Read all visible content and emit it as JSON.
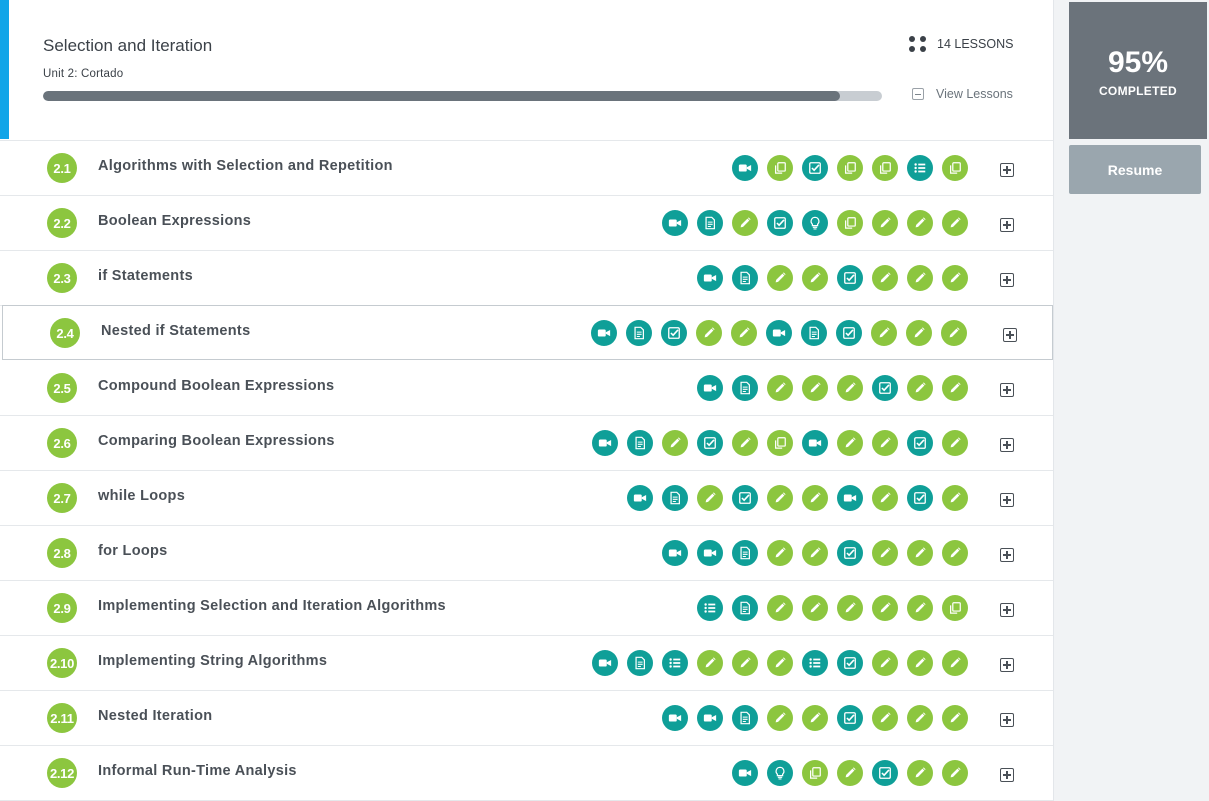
{
  "unit": {
    "title": "Selection and Iteration",
    "subtitle": "Unit 2: Cortado",
    "progress": 0.95,
    "lessons_count_label": "14 LESSONS",
    "view_lessons_label": "View Lessons"
  },
  "completion": {
    "percent_label": "95%",
    "completed_label": "COMPLETED",
    "resume_label": "Resume"
  },
  "colors": {
    "accent": "#10a5e8",
    "teal": "#0f9f98",
    "green": "#8cc63f",
    "completion_box": "#6b737b",
    "resume_button": "#9aa6ae"
  },
  "lessons": [
    {
      "num": "2.1",
      "title": "Algorithms with Selection and Repetition",
      "activities": [
        {
          "icon": "video",
          "color": "teal"
        },
        {
          "icon": "copy",
          "color": "green"
        },
        {
          "icon": "check",
          "color": "teal"
        },
        {
          "icon": "copy",
          "color": "green"
        },
        {
          "icon": "copy",
          "color": "green"
        },
        {
          "icon": "list",
          "color": "teal"
        },
        {
          "icon": "copy",
          "color": "green"
        }
      ]
    },
    {
      "num": "2.2",
      "title": "Boolean Expressions",
      "activities": [
        {
          "icon": "video",
          "color": "teal"
        },
        {
          "icon": "document",
          "color": "teal"
        },
        {
          "icon": "pencil",
          "color": "green"
        },
        {
          "icon": "check",
          "color": "teal"
        },
        {
          "icon": "bulb",
          "color": "teal"
        },
        {
          "icon": "copy",
          "color": "green"
        },
        {
          "icon": "pencil",
          "color": "green"
        },
        {
          "icon": "pencil",
          "color": "green"
        },
        {
          "icon": "pencil",
          "color": "green"
        }
      ]
    },
    {
      "num": "2.3",
      "title": "if Statements",
      "activities": [
        {
          "icon": "video",
          "color": "teal"
        },
        {
          "icon": "document",
          "color": "teal"
        },
        {
          "icon": "pencil",
          "color": "green"
        },
        {
          "icon": "pencil",
          "color": "green"
        },
        {
          "icon": "check",
          "color": "teal"
        },
        {
          "icon": "pencil",
          "color": "green"
        },
        {
          "icon": "pencil",
          "color": "green"
        },
        {
          "icon": "pencil",
          "color": "green"
        }
      ]
    },
    {
      "num": "2.4",
      "title": "Nested if Statements",
      "activities": [
        {
          "icon": "video",
          "color": "teal"
        },
        {
          "icon": "document",
          "color": "teal"
        },
        {
          "icon": "check",
          "color": "teal"
        },
        {
          "icon": "pencil",
          "color": "green"
        },
        {
          "icon": "pencil",
          "color": "green"
        },
        {
          "icon": "video",
          "color": "teal"
        },
        {
          "icon": "document",
          "color": "teal"
        },
        {
          "icon": "check",
          "color": "teal"
        },
        {
          "icon": "pencil",
          "color": "green"
        },
        {
          "icon": "pencil",
          "color": "green"
        },
        {
          "icon": "pencil",
          "color": "green"
        }
      ]
    },
    {
      "num": "2.5",
      "title": "Compound Boolean Expressions",
      "activities": [
        {
          "icon": "video",
          "color": "teal"
        },
        {
          "icon": "document",
          "color": "teal"
        },
        {
          "icon": "pencil",
          "color": "green"
        },
        {
          "icon": "pencil",
          "color": "green"
        },
        {
          "icon": "pencil",
          "color": "green"
        },
        {
          "icon": "check",
          "color": "teal"
        },
        {
          "icon": "pencil",
          "color": "green"
        },
        {
          "icon": "pencil",
          "color": "green"
        }
      ]
    },
    {
      "num": "2.6",
      "title": "Comparing Boolean Expressions",
      "activities": [
        {
          "icon": "video",
          "color": "teal"
        },
        {
          "icon": "document",
          "color": "teal"
        },
        {
          "icon": "pencil",
          "color": "green"
        },
        {
          "icon": "check",
          "color": "teal"
        },
        {
          "icon": "pencil",
          "color": "green"
        },
        {
          "icon": "copy",
          "color": "green"
        },
        {
          "icon": "video",
          "color": "teal"
        },
        {
          "icon": "pencil",
          "color": "green"
        },
        {
          "icon": "pencil",
          "color": "green"
        },
        {
          "icon": "check",
          "color": "teal"
        },
        {
          "icon": "pencil",
          "color": "green"
        }
      ]
    },
    {
      "num": "2.7",
      "title": "while Loops",
      "activities": [
        {
          "icon": "video",
          "color": "teal"
        },
        {
          "icon": "document",
          "color": "teal"
        },
        {
          "icon": "pencil",
          "color": "green"
        },
        {
          "icon": "check",
          "color": "teal"
        },
        {
          "icon": "pencil",
          "color": "green"
        },
        {
          "icon": "pencil",
          "color": "green"
        },
        {
          "icon": "video",
          "color": "teal"
        },
        {
          "icon": "pencil",
          "color": "green"
        },
        {
          "icon": "check",
          "color": "teal"
        },
        {
          "icon": "pencil",
          "color": "green"
        }
      ]
    },
    {
      "num": "2.8",
      "title": "for Loops",
      "activities": [
        {
          "icon": "video",
          "color": "teal"
        },
        {
          "icon": "video",
          "color": "teal"
        },
        {
          "icon": "document",
          "color": "teal"
        },
        {
          "icon": "pencil",
          "color": "green"
        },
        {
          "icon": "pencil",
          "color": "green"
        },
        {
          "icon": "check",
          "color": "teal"
        },
        {
          "icon": "pencil",
          "color": "green"
        },
        {
          "icon": "pencil",
          "color": "green"
        },
        {
          "icon": "pencil",
          "color": "green"
        }
      ]
    },
    {
      "num": "2.9",
      "title": "Implementing Selection and Iteration Algorithms",
      "activities": [
        {
          "icon": "list",
          "color": "teal"
        },
        {
          "icon": "document",
          "color": "teal"
        },
        {
          "icon": "pencil",
          "color": "green"
        },
        {
          "icon": "pencil",
          "color": "green"
        },
        {
          "icon": "pencil",
          "color": "green"
        },
        {
          "icon": "pencil",
          "color": "green"
        },
        {
          "icon": "pencil",
          "color": "green"
        },
        {
          "icon": "copy",
          "color": "green"
        }
      ]
    },
    {
      "num": "2.10",
      "title": "Implementing String Algorithms",
      "activities": [
        {
          "icon": "video",
          "color": "teal"
        },
        {
          "icon": "document",
          "color": "teal"
        },
        {
          "icon": "list",
          "color": "teal"
        },
        {
          "icon": "pencil",
          "color": "green"
        },
        {
          "icon": "pencil",
          "color": "green"
        },
        {
          "icon": "pencil",
          "color": "green"
        },
        {
          "icon": "list",
          "color": "teal"
        },
        {
          "icon": "check",
          "color": "teal"
        },
        {
          "icon": "pencil",
          "color": "green"
        },
        {
          "icon": "pencil",
          "color": "green"
        },
        {
          "icon": "pencil",
          "color": "green"
        }
      ]
    },
    {
      "num": "2.11",
      "title": "Nested Iteration",
      "activities": [
        {
          "icon": "video",
          "color": "teal"
        },
        {
          "icon": "video",
          "color": "teal"
        },
        {
          "icon": "document",
          "color": "teal"
        },
        {
          "icon": "pencil",
          "color": "green"
        },
        {
          "icon": "pencil",
          "color": "green"
        },
        {
          "icon": "check",
          "color": "teal"
        },
        {
          "icon": "pencil",
          "color": "green"
        },
        {
          "icon": "pencil",
          "color": "green"
        },
        {
          "icon": "pencil",
          "color": "green"
        }
      ]
    },
    {
      "num": "2.12",
      "title": "Informal Run-Time Analysis",
      "activities": [
        {
          "icon": "video",
          "color": "teal"
        },
        {
          "icon": "bulb",
          "color": "teal"
        },
        {
          "icon": "copy",
          "color": "green"
        },
        {
          "icon": "pencil",
          "color": "green"
        },
        {
          "icon": "check",
          "color": "teal"
        },
        {
          "icon": "pencil",
          "color": "green"
        },
        {
          "icon": "pencil",
          "color": "green"
        }
      ]
    }
  ]
}
